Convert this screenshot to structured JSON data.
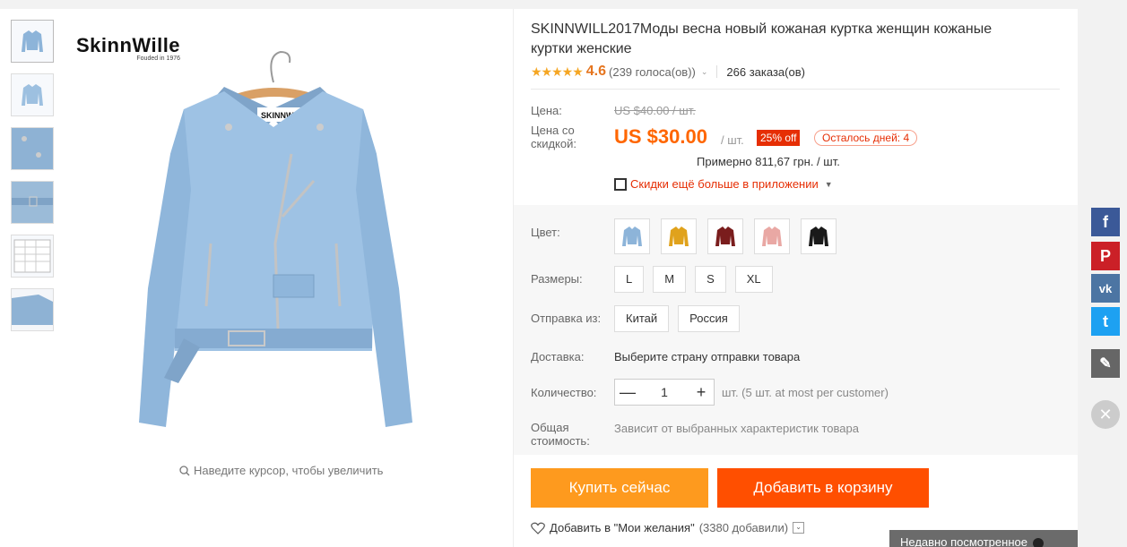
{
  "gallery": {
    "brand_name": "SkinnWille",
    "brand_tagline": "Fouded in 1976",
    "zoom_hint": "Наведите курсор, чтобы увеличить"
  },
  "product": {
    "title": "SKINNWILL2017Моды весна новый кожаная куртка женщин кожаные куртки женские",
    "rating_stars": "★★★★★",
    "rating_score": "4.6",
    "rating_votes": "(239 голоса(ов))",
    "orders": "266 заказа(ов)"
  },
  "price": {
    "label": "Цена:",
    "old": "US $40.00 / шт.",
    "discount_label": "Цена со скидкой:",
    "new": "US $30.00",
    "unit": "/ шт.",
    "discount_badge": "25% off",
    "days_left": "Осталось дней: 4",
    "approx": "Примерно 811,67 грн. / шт.",
    "app_promo": "Скидки ещё больше в приложении"
  },
  "options": {
    "color_label": "Цвет:",
    "colors": [
      "light-blue",
      "yellow",
      "burgundy",
      "pink",
      "black"
    ],
    "size_label": "Размеры:",
    "sizes": [
      "L",
      "M",
      "S",
      "XL"
    ],
    "ship_from_label": "Отправка из:",
    "ship_from": [
      "Китай",
      "Россия"
    ],
    "delivery_label": "Доставка:",
    "delivery_text": "Выберите страну отправки товара",
    "qty_label": "Количество:",
    "qty_value": "1",
    "qty_minus": "—",
    "qty_plus": "+",
    "qty_note": "шт. (5 шт. at most per customer)",
    "total_label": "Общая стоимость:",
    "total_text": "Зависит от выбранных характеристик товара"
  },
  "actions": {
    "buy_now": "Купить сейчас",
    "add_to_cart": "Добавить в корзину",
    "wishlist": "Добавить в \"Мои желания\"",
    "wishlist_count": "(3380 добавили)"
  },
  "sidebar": {
    "facebook": "f",
    "pinterest": "P",
    "vk": "vk",
    "twitter": "t",
    "edit": "✎",
    "close": "✕",
    "recently_viewed": "Недавно посмотренное"
  },
  "colors": {
    "orange": "#fe9a1e",
    "red_orange": "#ff4f00",
    "price": "#ff6600",
    "facebook": "#3b5998",
    "pinterest": "#cb2027",
    "vk": "#4c75a3",
    "twitter": "#1da1f2"
  }
}
